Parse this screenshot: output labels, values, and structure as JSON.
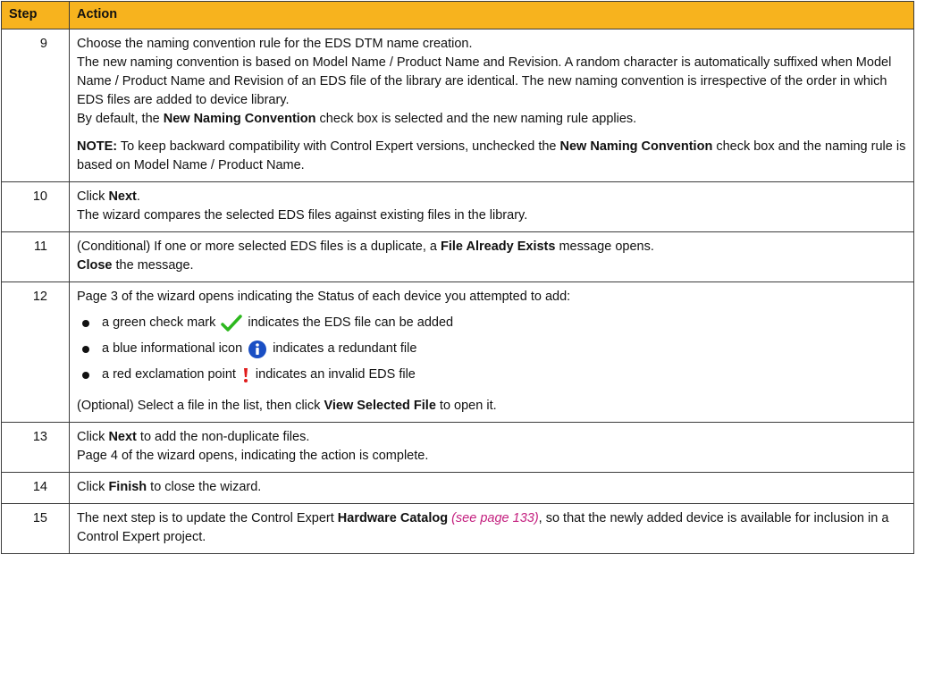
{
  "header": {
    "step": "Step",
    "action": "Action"
  },
  "rows": {
    "r9": {
      "num": "9",
      "line1": "Choose the naming convention rule for the EDS DTM name creation.",
      "line2": "The new naming convention is based on Model Name / Product Name and Revision. A random character is automatically suffixed when Model Name / Product Name and Revision of an EDS file of the library are identical. The new naming convention is irrespective of the order in which EDS files are added to device library.",
      "line3_a": "By default, the ",
      "line3_b": "New Naming Convention",
      "line3_c": " check box is selected and the new naming rule applies.",
      "note_label": "NOTE:",
      "note_a": " To keep backward compatibility with Control Expert versions, unchecked the ",
      "note_b": "New Naming Convention",
      "note_c": " check box and the naming rule is based on Model Name / Product Name."
    },
    "r10": {
      "num": "10",
      "a": "Click ",
      "b": "Next",
      "c": ".",
      "line2": "The wizard compares the selected EDS files against existing files in the library."
    },
    "r11": {
      "num": "11",
      "a": "(Conditional) If one or more selected EDS files is a duplicate, a ",
      "b": "File Already Exists",
      "c": " message opens.",
      "d": "Close",
      "e": " the message."
    },
    "r12": {
      "num": "12",
      "intro": "Page 3 of the wizard opens indicating the Status of each device you attempted to add:",
      "bullets": [
        {
          "pre": "a green check mark",
          "icon": "check-icon",
          "post": "indicates the EDS file can be added"
        },
        {
          "pre": "a blue informational icon",
          "icon": "info-icon",
          "post": "indicates a redundant file"
        },
        {
          "pre": "a red exclamation point",
          "icon": "exclamation-icon",
          "post": "indicates an invalid EDS file"
        }
      ],
      "opt_a": "(Optional) Select a file in the list, then click ",
      "opt_b": "View Selected File",
      "opt_c": " to open it."
    },
    "r13": {
      "num": "13",
      "a": "Click ",
      "b": "Next",
      "c": " to add the non-duplicate files.",
      "line2": "Page 4 of the wizard opens, indicating the action is complete."
    },
    "r14": {
      "num": "14",
      "a": "Click ",
      "b": "Finish",
      "c": " to close the wizard."
    },
    "r15": {
      "num": "15",
      "a": "The next step is to update the Control Expert ",
      "b": "Hardware Catalog",
      "link": " (see page 133)",
      "c": ", so that the newly added device is available for inclusion in a Control Expert project."
    }
  },
  "colors": {
    "header_bg": "#f7b31e",
    "link": "#c4207f",
    "check": "#2db81e",
    "info": "#1a4fc4",
    "exclamation": "#e01b1b"
  }
}
